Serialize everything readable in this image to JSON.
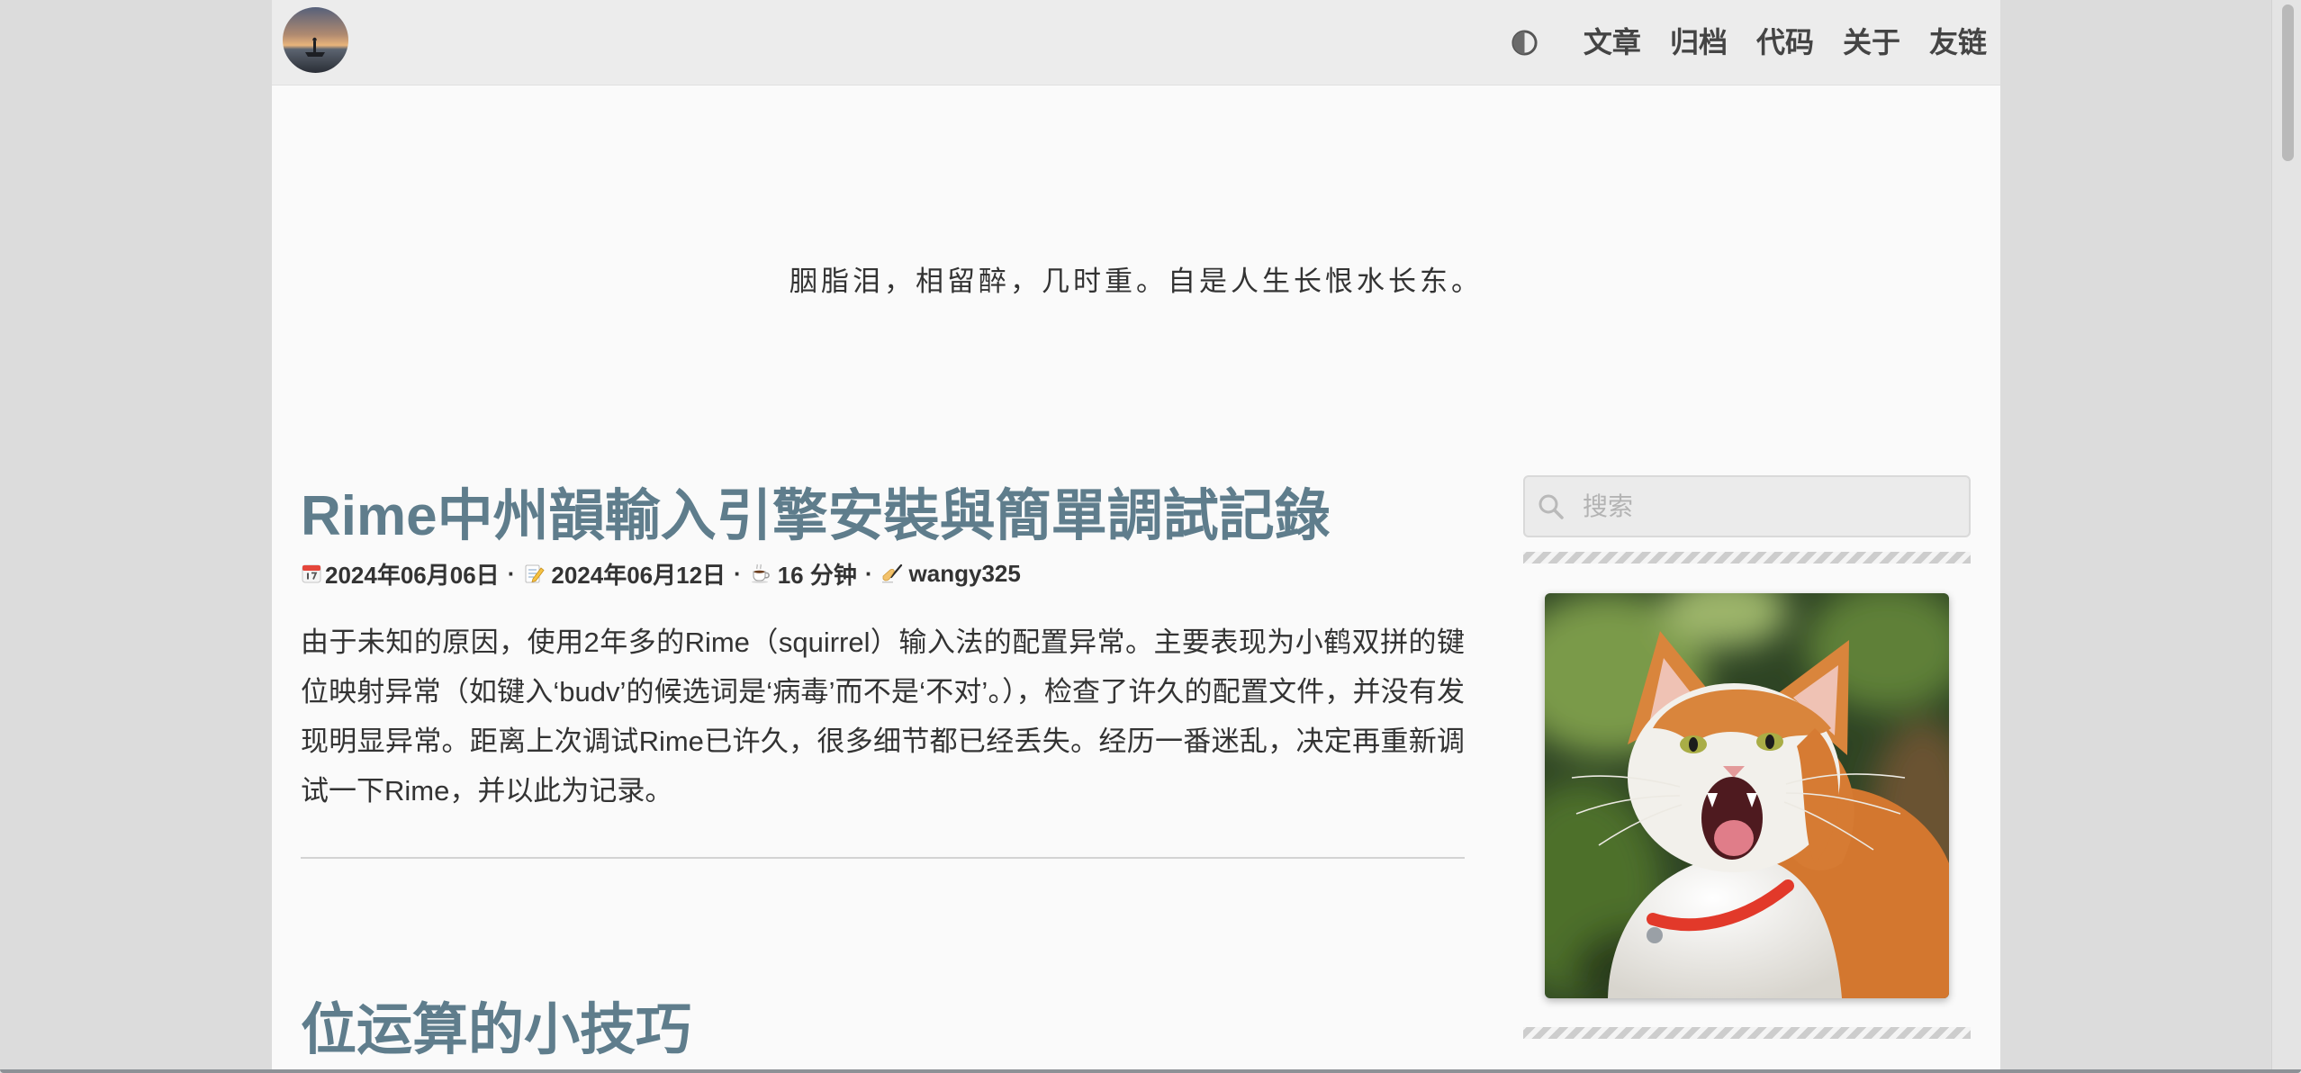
{
  "header": {
    "avatar_icon": "avatar-image",
    "theme_toggle_icon": "half-circle-icon",
    "nav": [
      {
        "label": "文章"
      },
      {
        "label": "归档"
      },
      {
        "label": "代码"
      },
      {
        "label": "关于"
      },
      {
        "label": "友链"
      }
    ]
  },
  "hero": {
    "quote": "胭脂泪，相留醉，几时重。自是人生长恨水长东。"
  },
  "posts": [
    {
      "title": "Rime中州韻輸入引擎安裝與簡單調試記錄",
      "meta": {
        "separator": "·",
        "created_icon": "calendar-icon",
        "created": "2024年06月06日",
        "updated_icon": "memo-icon",
        "updated": "2024年06月12日",
        "reading_icon": "coffee-icon",
        "reading_time": "16 分钟",
        "author_icon": "writing-hand-icon",
        "author": "wangy325"
      },
      "excerpt": "由于未知的原因，使用2年多的Rime（squirrel）输入法的配置异常。主要表现为小鹤双拼的键位映射异常（如键入‘budv’的候选词是‘病毒’而不是‘不对’。），检查了许久的配置文件，并没有发现明显异常。距离上次调试Rime已许久，很多细节都已经丢失。经历一番迷乱，决定再重新调试一下Rime，并以此为记录。"
    },
    {
      "title": "位运算的小技巧"
    }
  ],
  "sidebar": {
    "search": {
      "icon": "search-icon",
      "placeholder": "搜索",
      "value": ""
    },
    "image_icon": "cat-image"
  },
  "colors": {
    "accent": "#5f7d8c",
    "text": "#333333",
    "background": "#fafafa",
    "header": "#ececec",
    "outer": "#dcdcdc"
  }
}
